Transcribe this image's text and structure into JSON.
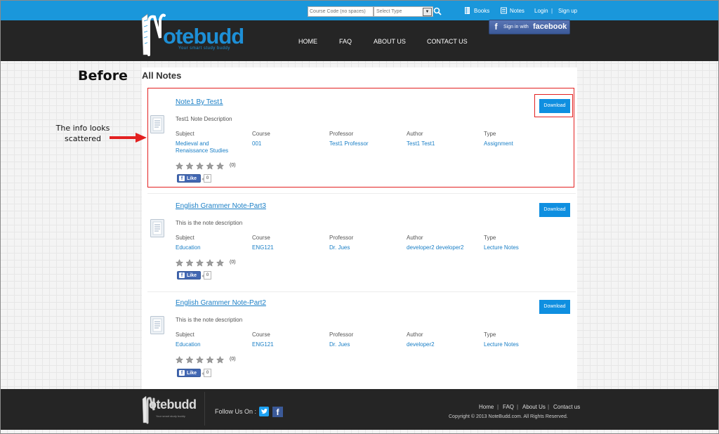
{
  "topbar": {
    "course_placeholder": "Course Code (no spaces)",
    "type_select_value": "Select Type",
    "links": {
      "books": "Books",
      "notes": "Notes",
      "login": "Login",
      "signup": "Sign up"
    },
    "separator": "|"
  },
  "header": {
    "logo_text": "otebudd",
    "logo_tagline": "Your smart study buddy",
    "nav": [
      "HOME",
      "FAQ",
      "ABOUT US",
      "CONTACT US"
    ],
    "fb_signin": {
      "prefix": "Sign in with",
      "brand": "facebook"
    }
  },
  "annotations": {
    "before_label": "Before",
    "note_line1": "The info looks",
    "note_line2": "scattered"
  },
  "main": {
    "title": "All Notes",
    "column_headers": {
      "subject": "Subject",
      "course": "Course",
      "professor": "Professor",
      "author": "Author",
      "type": "Type"
    },
    "download_label": "Download",
    "like_label": "Like",
    "notes": [
      {
        "title": "Note1 By Test1",
        "description": "Test1 Note Description",
        "subject_line1": "Medieval and",
        "subject_line2": "Renaissance Studies",
        "course": "001",
        "professor": "Test1 Professor",
        "author": "Test1 Test1",
        "type": "Assignment",
        "rating_count": "(0)",
        "likes": "0"
      },
      {
        "title": "English Grammer Note-Part3",
        "description": "This is the note description",
        "subject_line1": "Education",
        "subject_line2": "",
        "course": "ENG121",
        "professor": "Dr. Jues",
        "author": "developer2 developer2",
        "type": "Lecture Notes",
        "rating_count": "(0)",
        "likes": "0"
      },
      {
        "title": "English Grammer Note-Part2",
        "description": "This is the note description",
        "subject_line1": "Education",
        "subject_line2": "",
        "course": "ENG121",
        "professor": "Dr. Jues",
        "author": "developer2",
        "type": "Lecture Notes",
        "rating_count": "(0)",
        "likes": "0"
      }
    ]
  },
  "footer": {
    "logo_text": "otebudd",
    "logo_tagline": "Your smart study buddy",
    "follow_label": "Follow Us On :",
    "links": [
      "Home",
      "FAQ",
      "About Us",
      "Contact us"
    ],
    "separator": "|",
    "copyright": "Copyright © 2013 NoteBudd.com. All Rights Reserved."
  },
  "colors": {
    "topbar_blue": "#1a97db",
    "header_dark": "#252525",
    "link_blue": "#1a7fc6",
    "download_blue": "#0f8fe0",
    "annotation_red": "#e32121",
    "facebook_blue": "#3b5998"
  }
}
